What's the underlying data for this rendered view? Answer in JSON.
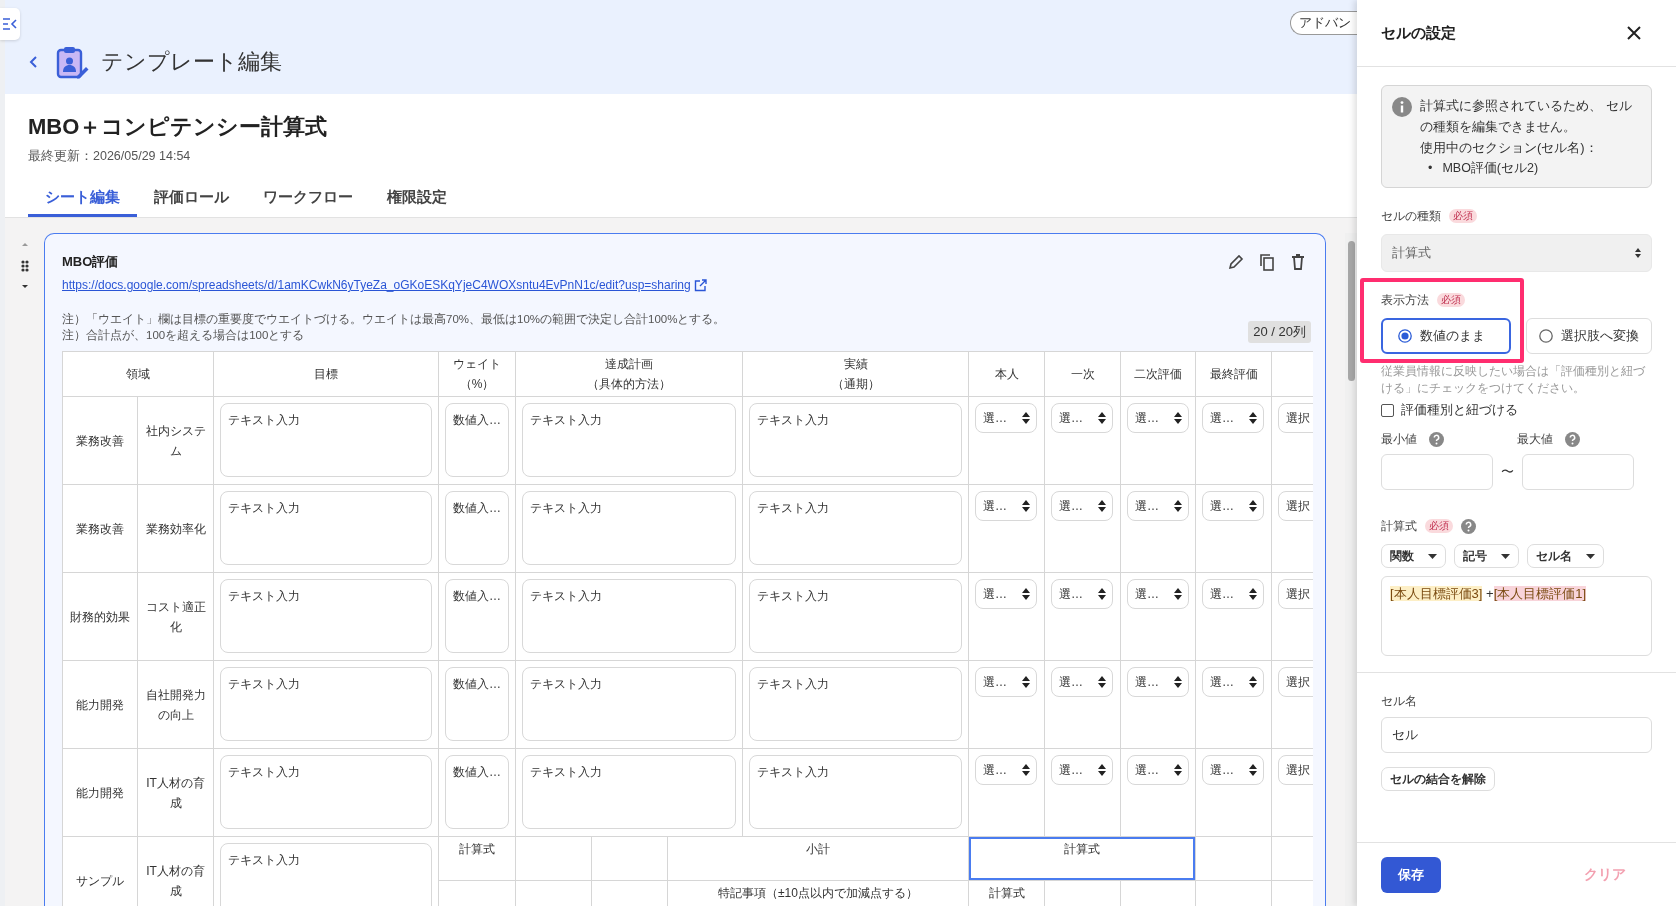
{
  "header": {
    "title": "テンプレート編集",
    "advanced_button": "アドバン"
  },
  "template": {
    "name": "MBO＋コンピテンシー計算式",
    "updated": "最終更新：2026/05/29 14:54"
  },
  "tabs": [
    {
      "label": "シート編集",
      "selected": true
    },
    {
      "label": "評価ロール",
      "selected": false
    },
    {
      "label": "ワークフロー",
      "selected": false
    },
    {
      "label": "権限設定",
      "selected": false
    }
  ],
  "section": {
    "title": "MBO評価",
    "link": "https://docs.google.com/spreadsheets/d/1amKCwkN6yTyeZa_oGKoESKqYjeC4WOXsntu4EvPnN1c/edit?usp=sharing",
    "notes": [
      "注）「ウエイト」欄は目標の重要度でウエイトづける。ウエイトは最高70%、最低は10%の範囲で決定し合計100%とする。",
      "注）合計点が、100を超える場合は100とする"
    ],
    "column_count": "20 / 20列",
    "table": {
      "header": [
        {
          "lines": [
            "領域"
          ],
          "colspan": 2
        },
        {
          "lines": [
            "目標"
          ]
        },
        {
          "lines": [
            "ウェイト",
            "（%）"
          ]
        },
        {
          "lines": [
            "達成計画",
            "（具体的方法）"
          ],
          "colspan": 3
        },
        {
          "lines": [
            "実績",
            "（通期）"
          ]
        },
        {
          "lines": [
            "本人"
          ]
        },
        {
          "lines": [
            "一次"
          ]
        },
        {
          "lines": [
            "二次評価"
          ]
        },
        {
          "lines": [
            "最終評価"
          ]
        }
      ],
      "rows": [
        {
          "cells": [
            {
              "kind": "label",
              "text": "業務改善"
            },
            {
              "kind": "label",
              "text": "社内システム"
            },
            {
              "kind": "textarea",
              "placeholder": "テキスト入力"
            },
            {
              "kind": "number",
              "placeholder": "数値入…"
            },
            {
              "kind": "textarea",
              "placeholder": "テキスト入力",
              "colspan": 3
            },
            {
              "kind": "textarea",
              "placeholder": "テキスト入力"
            },
            {
              "kind": "select",
              "value": "選…"
            },
            {
              "kind": "select",
              "value": "選…"
            },
            {
              "kind": "select",
              "value": "選…"
            },
            {
              "kind": "select",
              "value": "選…"
            },
            {
              "kind": "select",
              "value": "選択"
            }
          ]
        },
        {
          "cells": [
            {
              "kind": "label",
              "text": "業務改善"
            },
            {
              "kind": "label",
              "text": "業務効率化"
            },
            {
              "kind": "textarea",
              "placeholder": "テキスト入力"
            },
            {
              "kind": "number",
              "placeholder": "数値入…"
            },
            {
              "kind": "textarea",
              "placeholder": "テキスト入力",
              "colspan": 3
            },
            {
              "kind": "textarea",
              "placeholder": "テキスト入力"
            },
            {
              "kind": "select",
              "value": "選…"
            },
            {
              "kind": "select",
              "value": "選…"
            },
            {
              "kind": "select",
              "value": "選…"
            },
            {
              "kind": "select",
              "value": "選…"
            },
            {
              "kind": "select",
              "value": "選択"
            }
          ]
        },
        {
          "cells": [
            {
              "kind": "label",
              "text": "財務的効果"
            },
            {
              "kind": "label",
              "text": "コスト適正化"
            },
            {
              "kind": "textarea",
              "placeholder": "テキスト入力"
            },
            {
              "kind": "number",
              "placeholder": "数値入…"
            },
            {
              "kind": "textarea",
              "placeholder": "テキスト入力",
              "colspan": 3
            },
            {
              "kind": "textarea",
              "placeholder": "テキスト入力"
            },
            {
              "kind": "select",
              "value": "選…"
            },
            {
              "kind": "select",
              "value": "選…"
            },
            {
              "kind": "select",
              "value": "選…"
            },
            {
              "kind": "select",
              "value": "選…"
            },
            {
              "kind": "select",
              "value": "選択"
            }
          ]
        },
        {
          "cells": [
            {
              "kind": "label",
              "text": "能力開発"
            },
            {
              "kind": "label",
              "text": "自社開発力の向上"
            },
            {
              "kind": "textarea",
              "placeholder": "テキスト入力"
            },
            {
              "kind": "number",
              "placeholder": "数値入…"
            },
            {
              "kind": "textarea",
              "placeholder": "テキスト入力",
              "colspan": 3
            },
            {
              "kind": "textarea",
              "placeholder": "テキスト入力"
            },
            {
              "kind": "select",
              "value": "選…"
            },
            {
              "kind": "select",
              "value": "選…"
            },
            {
              "kind": "select",
              "value": "選…"
            },
            {
              "kind": "select",
              "value": "選…"
            },
            {
              "kind": "select",
              "value": "選択"
            }
          ]
        },
        {
          "cells": [
            {
              "kind": "label",
              "text": "能力開発"
            },
            {
              "kind": "label",
              "text": "IT人材の育成"
            },
            {
              "kind": "textarea",
              "placeholder": "テキスト入力"
            },
            {
              "kind": "number",
              "placeholder": "数値入…"
            },
            {
              "kind": "textarea",
              "placeholder": "テキスト入力",
              "colspan": 3
            },
            {
              "kind": "textarea",
              "placeholder": "テキスト入力"
            },
            {
              "kind": "select",
              "value": "選…"
            },
            {
              "kind": "select",
              "value": "選…"
            },
            {
              "kind": "select",
              "value": "選…"
            },
            {
              "kind": "select",
              "value": "選…"
            },
            {
              "kind": "select",
              "value": "選択"
            }
          ]
        },
        {
          "cells": [
            {
              "kind": "label",
              "text": "サンプル"
            },
            {
              "kind": "label",
              "text": "IT人材の育成"
            },
            {
              "kind": "textarea",
              "placeholder": "テキスト入力"
            }
          ],
          "sub_rows": [
            {
              "cells": [
                {
                  "kind": "label",
                  "text": "計算式",
                  "selected": false
                },
                {
                  "kind": "empty",
                  "selected": false
                },
                {
                  "kind": "empty",
                  "selected": false
                },
                {
                  "kind": "label",
                  "text": "小計",
                  "colspan": 2,
                  "selected": false
                },
                {
                  "kind": "label",
                  "text": "計算式",
                  "colspan": 3,
                  "selected": true
                },
                {
                  "kind": "empty",
                  "selected": false
                },
                {
                  "kind": "empty",
                  "selected": false
                }
              ]
            },
            {
              "cells": [
                {
                  "kind": "empty",
                  "selected": false
                },
                {
                  "kind": "empty",
                  "selected": false
                },
                {
                  "kind": "empty",
                  "selected": false
                },
                {
                  "kind": "label",
                  "text": "特記事項（±10点以内で加減点する）",
                  "colspan": 2,
                  "selected": false
                },
                {
                  "kind": "label",
                  "text": "計算式",
                  "selected": false
                },
                {
                  "kind": "empty",
                  "selected": false
                },
                {
                  "kind": "empty",
                  "selected": false
                },
                {
                  "kind": "empty",
                  "selected": false
                },
                {
                  "kind": "empty",
                  "selected": false
                }
              ]
            }
          ]
        }
      ]
    }
  },
  "panel": {
    "title": "セルの設定",
    "notice": {
      "message": "計算式に参照されているため、 セルの種類を編集できません。",
      "usage_label": "使用中のセクション(セル名)：",
      "usage_items": [
        {
          "bullet": "•",
          "text": "MBO評価(セル2)"
        }
      ]
    },
    "cell_type": {
      "label": "セルの種類",
      "required": "必須",
      "value": "計算式",
      "disabled": true
    },
    "display_method": {
      "label": "表示方法",
      "required": "必須",
      "highlighted": true,
      "options": [
        {
          "label": "数値のまま",
          "selected": true
        },
        {
          "label": "選択肢へ変換",
          "selected": false
        }
      ],
      "hint": "従業員情報に反映したい場合は「評価種別と紐づける」にチェックをつけてください。",
      "checkbox": {
        "label": "評価種別と紐づける",
        "checked": false
      }
    },
    "range": {
      "min_label": "最小値",
      "max_label": "最大値",
      "separator": "〜"
    },
    "formula": {
      "label": "計算式",
      "required": "必須",
      "menus": [
        "関数",
        "記号",
        "セル名"
      ],
      "tokens": [
        {
          "kind": "ref",
          "text": "[本人目標評価3]",
          "color": "#fdefc6"
        },
        {
          "kind": "operator",
          "text": " +"
        },
        {
          "kind": "ref",
          "text": "[本人目標評価1]",
          "color": "#f8d4da"
        }
      ]
    },
    "cell_name": {
      "label": "セル名",
      "value": "セル"
    },
    "unmerge_button": "セルの結合を解除",
    "footer": {
      "save": "保存",
      "clear": "クリア"
    }
  }
}
